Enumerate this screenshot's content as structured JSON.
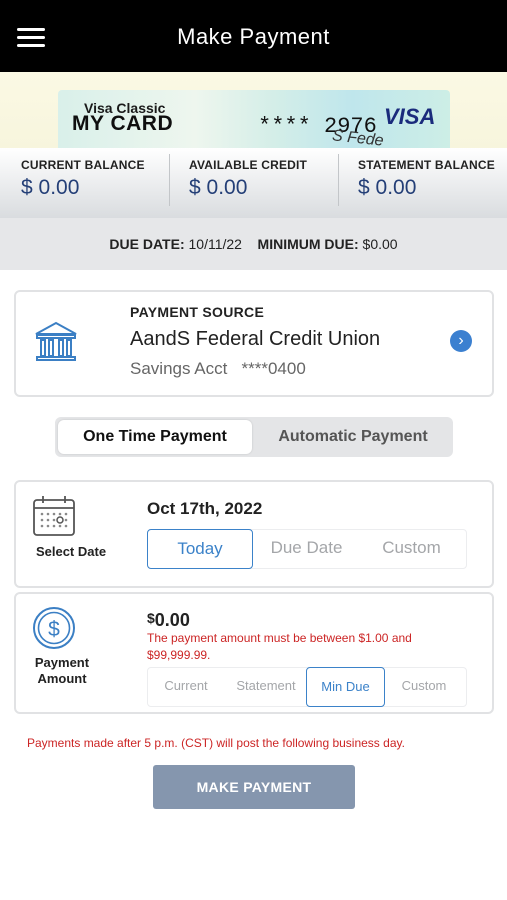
{
  "header": {
    "title": "Make Payment"
  },
  "card": {
    "type_label": "Visa Classic",
    "name": "MY CARD",
    "masked_number": "**** 2976",
    "brand": "VISA",
    "partial_text": "S Fede"
  },
  "balances": [
    {
      "label": "CURRENT BALANCE",
      "value": "$ 0.00"
    },
    {
      "label": "AVAILABLE CREDIT",
      "value": "$ 0.00"
    },
    {
      "label": "STATEMENT BALANCE",
      "value": "$ 0.00"
    }
  ],
  "due": {
    "due_date_label": "DUE DATE:",
    "due_date_value": "10/11/22",
    "min_due_label": "MINIMUM DUE:",
    "min_due_value": "$0.00"
  },
  "payment_source": {
    "label": "PAYMENT SOURCE",
    "institution": "AandS Federal Credit Union",
    "account_type": "Savings Acct",
    "account_mask": "****0400",
    "icon": "bank-icon"
  },
  "payment_type": {
    "options": [
      "One Time Payment",
      "Automatic Payment"
    ],
    "selected": "One Time Payment"
  },
  "select_date": {
    "label": "Select Date",
    "date": "Oct 17th, 2022",
    "options": [
      "Today",
      "Due Date",
      "Custom"
    ],
    "selected": "Today",
    "icon": "calendar-icon"
  },
  "payment_amount": {
    "label_line1": "Payment",
    "label_line2": "Amount",
    "currency": "$",
    "amount": "0.00",
    "error": "The payment amount must be between $1.00 and $99,999.99.",
    "options": [
      "Current",
      "Statement",
      "Min Due",
      "Custom"
    ],
    "selected": "Min Due",
    "icon": "dollar-icon"
  },
  "notice": "Payments made after 5 p.m. (CST) will post the following business day.",
  "submit_label": "MAKE PAYMENT",
  "colors": {
    "header_bg": "#000000",
    "accent": "#3b82c9",
    "balance_text": "#243f77",
    "error": "#cc2525",
    "button_bg": "#8596ae"
  }
}
